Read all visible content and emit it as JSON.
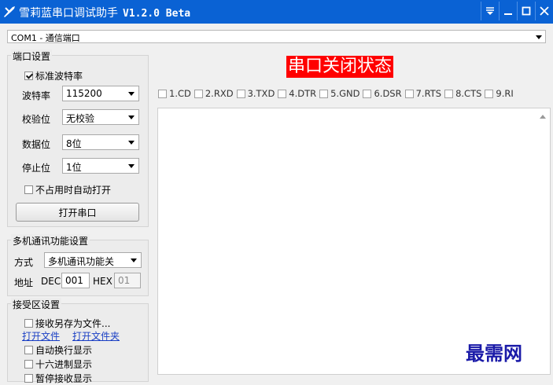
{
  "titlebar": {
    "title": "雪莉蓝串口调试助手",
    "version": "V1.2.0 Beta",
    "bg_color": "#0a62d4"
  },
  "port": {
    "selected": "COM1 - 通信端口"
  },
  "port_settings": {
    "group_title": "端口设置",
    "std_baud_label": "标准波特率",
    "std_baud_checked": true,
    "baud_label": "波特率",
    "baud_value": "115200",
    "parity_label": "校验位",
    "parity_value": "无校验",
    "databits_label": "数据位",
    "databits_value": "8位",
    "stopbits_label": "停止位",
    "stopbits_value": "1位",
    "auto_open_label": "不占用时自动打开",
    "auto_open_checked": false,
    "open_button": "打开串口"
  },
  "multi": {
    "group_title": "多机通讯功能设置",
    "mode_label": "方式",
    "mode_value": "多机通讯功能关",
    "addr_label": "地址",
    "dec_label": "DEC",
    "dec_value": "001",
    "hex_label": "HEX",
    "hex_value": "01"
  },
  "recv_settings": {
    "group_title": "接受区设置",
    "save_to_file": "接收另存为文件...",
    "open_file": "打开文件",
    "open_folder": "打开文件夹",
    "auto_wrap": "自动换行显示",
    "hex_display": "十六进制显示",
    "partial_next": "暂停接收显示"
  },
  "status": {
    "text": "串口关闭状态",
    "color": "#ff0000"
  },
  "signals": [
    "1.CD",
    "2.RXD",
    "3.TXD",
    "4.DTR",
    "5.GND",
    "6.DSR",
    "7.RTS",
    "8.CTS",
    "9.RI"
  ],
  "watermark": "最需网"
}
